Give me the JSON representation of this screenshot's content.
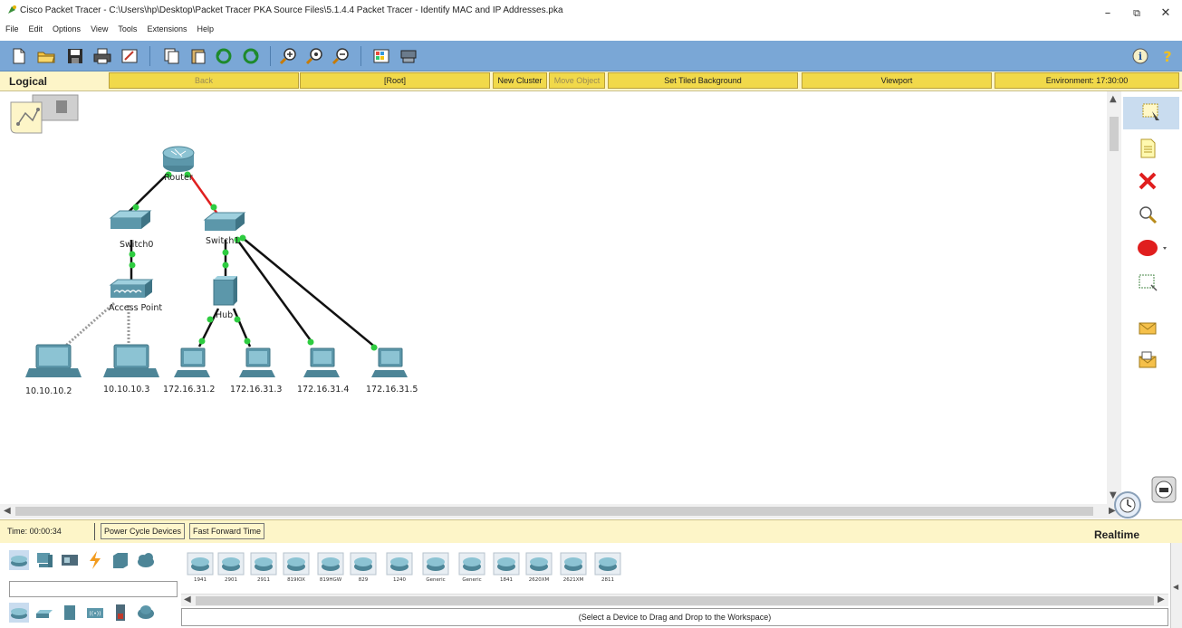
{
  "window": {
    "title": "Cisco Packet Tracer - C:\\Users\\hp\\Desktop\\Packet Tracer PKA Source Files\\5.1.4.4 Packet Tracer - Identify MAC and IP Addresses.pka",
    "minimize_glyph": "–",
    "restore_glyph": "⧉",
    "close_glyph": "✕"
  },
  "menu": [
    "File",
    "Edit",
    "Options",
    "View",
    "Tools",
    "Extensions",
    "Help"
  ],
  "toolbar": {
    "icons": [
      "new-icon",
      "open-icon",
      "save-icon",
      "print-icon",
      "activity-wizard-icon",
      "copy-icon",
      "paste-icon",
      "undo-icon",
      "redo-icon",
      "zoom-in-icon",
      "zoom-reset-icon",
      "zoom-out-icon",
      "palette-icon",
      "custom-device-icon"
    ],
    "right_icons": [
      "info-icon",
      "help-icon"
    ]
  },
  "logical_bar": {
    "label": "Logical",
    "back": "Back",
    "root": "[Root]",
    "new_cluster": "New Cluster",
    "move_object": "Move Object",
    "set_tiled_background": "Set Tiled Background",
    "viewport": "Viewport",
    "environment": "Environment: 17:30:00"
  },
  "topology": {
    "devices": [
      {
        "id": "router",
        "label": "Router",
        "type": "router"
      },
      {
        "id": "switch0",
        "label": "Switch0",
        "type": "switch"
      },
      {
        "id": "switch1",
        "label": "Switch1",
        "type": "switch"
      },
      {
        "id": "ap",
        "label": "Access Point",
        "type": "access-point"
      },
      {
        "id": "hub",
        "label": "Hub",
        "type": "hub"
      },
      {
        "id": "laptop1",
        "label": "10.10.10.2",
        "type": "laptop"
      },
      {
        "id": "laptop2",
        "label": "10.10.10.3",
        "type": "laptop"
      },
      {
        "id": "pc1",
        "label": "172.16.31.2",
        "type": "pc"
      },
      {
        "id": "pc2",
        "label": "172.16.31.3",
        "type": "pc"
      },
      {
        "id": "pc3",
        "label": "172.16.31.4",
        "type": "pc"
      },
      {
        "id": "pc4",
        "label": "172.16.31.5",
        "type": "pc"
      }
    ],
    "link_colors": {
      "up": "#111111",
      "down": "#e02020",
      "wireless": "#9a9a9a",
      "port_up": "#2ecc40"
    }
  },
  "right_tools": [
    "select-icon",
    "place-note-icon",
    "delete-icon",
    "inspect-icon",
    "draw-shape-icon",
    "resize-shape-icon",
    "add-simple-pdu-icon",
    "add-complex-pdu-icon"
  ],
  "status": {
    "time": "Time: 00:00:34",
    "power_cycle": "Power Cycle Devices",
    "fast_forward": "Fast Forward Time",
    "mode": "Realtime"
  },
  "device_panel": {
    "categories": [
      "network-devices-icon",
      "end-devices-icon",
      "components-icon",
      "connections-icon",
      "misc-icon",
      "multiuser-icon"
    ],
    "subcategories": [
      "routers-icon",
      "switches-icon",
      "hubs-icon",
      "wireless-devices-icon",
      "security-icon",
      "wan-emulation-icon"
    ],
    "models": [
      "1941",
      "2901",
      "2911",
      "819IOX",
      "819HGW",
      "829",
      "1240",
      "Generic",
      "Generic",
      "1841",
      "2620XM",
      "2621XM",
      "2811"
    ],
    "hint": "(Select a Device to Drag and Drop to the Workspace)"
  }
}
